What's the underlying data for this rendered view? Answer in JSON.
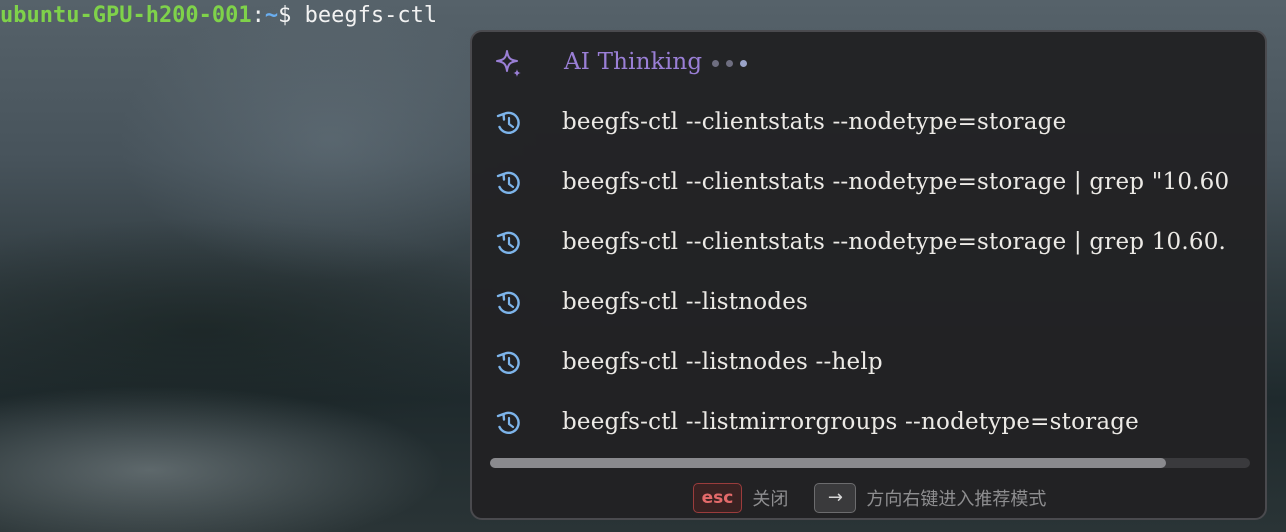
{
  "terminal": {
    "user_host": "ubuntu-GPU-h200-001",
    "separator": ":",
    "path": "~",
    "prompt": "$ ",
    "command": "beegfs-ctl"
  },
  "popup": {
    "thinking": {
      "label": "AI Thinking",
      "icon": "sparkle-icon",
      "accent_color": "#9a7fd6"
    },
    "history_icon": "history-icon",
    "suggestions": [
      "beegfs-ctl --clientstats --nodetype=storage",
      "beegfs-ctl --clientstats --nodetype=storage | grep \"10.60",
      "beegfs-ctl --clientstats --nodetype=storage | grep 10.60.",
      "beegfs-ctl --listnodes",
      "beegfs-ctl --listnodes --help",
      "beegfs-ctl --listmirrorgroups --nodetype=storage"
    ],
    "footer": {
      "esc_key": "esc",
      "esc_label": "关闭",
      "arrow_key": "→",
      "arrow_label": "方向右键进入推荐模式"
    }
  },
  "colors": {
    "user_host": "#7fd24a",
    "path": "#6aaef0",
    "history_icon": "#7db4ea",
    "esc": "#e36a6a"
  }
}
